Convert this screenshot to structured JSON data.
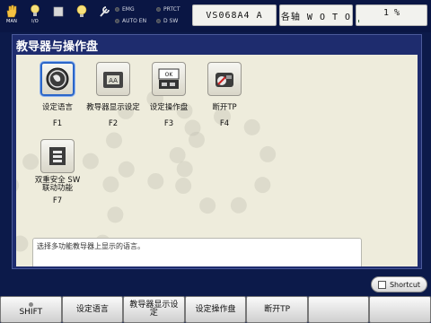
{
  "statusbar": {
    "icons": [
      {
        "name": "hand-icon",
        "label": "MAN"
      },
      {
        "name": "io-icon",
        "label": "I/O"
      },
      {
        "name": "stop-icon",
        "label": ""
      },
      {
        "name": "bulb-icon",
        "label": ""
      },
      {
        "name": "wrench-icon",
        "label": ""
      }
    ],
    "leds": [
      "EMG",
      "PRTCT",
      "AUTO EN",
      "D SW"
    ],
    "program": "VS068A4 A",
    "axis": "各轴 W O T O",
    "percent": "1 %",
    "percent_value": 1
  },
  "window": {
    "title": "教导器与操作盘",
    "tiles": [
      {
        "label": "设定语言",
        "key": "F1",
        "icon": "globe-icon"
      },
      {
        "label": "教导器显示设定",
        "key": "F2",
        "icon": "pendant-display-icon"
      },
      {
        "label": "设定操作盘",
        "key": "F3",
        "icon": "operation-panel-icon"
      },
      {
        "label": "断开TP",
        "key": "F4",
        "icon": "disconnect-tp-icon"
      },
      {
        "label": "双重安全 SW 联动功能",
        "key": "F7",
        "icon": "safety-switch-icon"
      }
    ],
    "description": "选择多功能教导器上显示的语言。"
  },
  "shortcut_label": "Shortcut",
  "fkeys": [
    "SHIFT",
    "设定语言",
    "教导器显示设定",
    "设定操作盘",
    "断开TP",
    "",
    ""
  ],
  "colors": {
    "accent": "#2b66c8",
    "window_title_bg": "#1e2c6e",
    "panel_bg": "#eeecdc"
  }
}
